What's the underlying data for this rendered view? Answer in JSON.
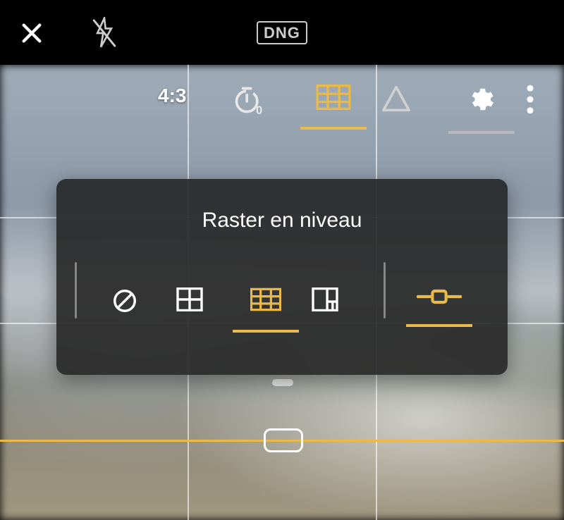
{
  "topbar": {
    "format_badge": "DNG"
  },
  "toolrow": {
    "aspect_ratio": "4:3"
  },
  "panel": {
    "title": "Raster en niveau"
  },
  "icons": {
    "close": "close-icon",
    "flash_off": "flash-off-icon",
    "timer": "timer-icon",
    "grid": "grid-icon",
    "triangle": "triangle-icon",
    "gear": "gear-icon",
    "more": "more-vert-icon",
    "none": "none-icon",
    "grid2x2": "grid-2x2-icon",
    "grid3x3": "grid-3x3-icon",
    "golden": "golden-ratio-icon",
    "level": "level-icon"
  },
  "colors": {
    "accent": "#e9b949",
    "panel_bg": "rgba(40,40,40,0.92)",
    "icon_inactive": "#d8d8d8",
    "icon_white": "#ffffff"
  }
}
